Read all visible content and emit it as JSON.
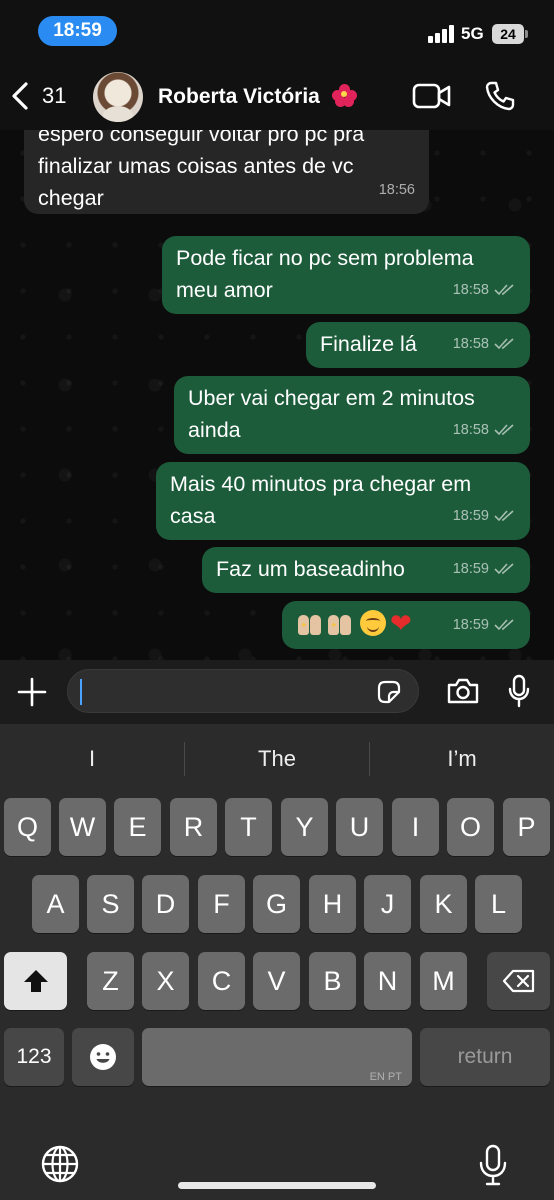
{
  "status_bar": {
    "time": "18:59",
    "network": "5G",
    "battery": "24",
    "colors": {
      "time_pill": "#2a8cf2"
    }
  },
  "header": {
    "back_count": "31",
    "contact_name": "Roberta Victória",
    "name_emoji": "hibiscus",
    "icons": [
      "chevron-left-icon",
      "video-camera-icon",
      "phone-icon"
    ]
  },
  "chat": {
    "colors": {
      "incoming_bubble": "#262626",
      "outgoing_bubble": "#1d5c3b"
    },
    "messages": [
      {
        "direction": "in",
        "text": "espero conseguir voltar pro pc pra finalizar umas coisas antes de vc chegar",
        "time": "18:56"
      },
      {
        "direction": "out",
        "text": "Pode ficar no pc sem problema meu amor",
        "time": "18:58",
        "status": "read"
      },
      {
        "direction": "out",
        "text": "Finalize lá",
        "time": "18:58",
        "status": "read"
      },
      {
        "direction": "out",
        "text": "Uber vai chegar em 2 minutos ainda",
        "time": "18:58",
        "status": "read"
      },
      {
        "direction": "out",
        "text": "Mais 40 minutos pra chegar em casa",
        "time": "18:59",
        "status": "read"
      },
      {
        "direction": "out",
        "text": "Faz um baseadinho",
        "time": "18:59",
        "status": "read"
      },
      {
        "direction": "out",
        "text": "🙌🏼🙌🏼😋❤️",
        "time": "18:59",
        "status": "read"
      }
    ]
  },
  "composer": {
    "value": "",
    "icons": [
      "plus-icon",
      "sticker-icon",
      "camera-icon",
      "microphone-icon"
    ]
  },
  "keyboard": {
    "suggestions": [
      "I",
      "The",
      "I’m"
    ],
    "rows": [
      [
        "Q",
        "W",
        "E",
        "R",
        "T",
        "Y",
        "U",
        "I",
        "O",
        "P"
      ],
      [
        "A",
        "S",
        "D",
        "F",
        "G",
        "H",
        "J",
        "K",
        "L"
      ],
      [
        "Z",
        "X",
        "C",
        "V",
        "B",
        "N",
        "M"
      ]
    ],
    "numbers_key": "123",
    "space_language": "EN PT",
    "return_key": "return",
    "icons": [
      "shift-icon",
      "backspace-icon",
      "emoji-icon",
      "globe-icon",
      "dictation-mic-icon"
    ]
  }
}
